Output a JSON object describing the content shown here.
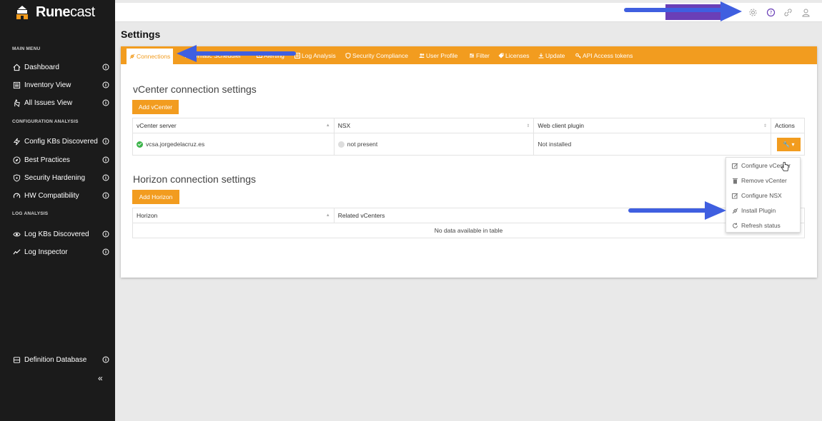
{
  "brand": {
    "name_a": "Rune",
    "name_b": "cast"
  },
  "sidebar": {
    "sections": [
      {
        "title": "MAIN MENU"
      },
      {
        "title": "CONFIGURATION ANALYSIS"
      },
      {
        "title": "LOG ANALYSIS"
      }
    ],
    "items": [
      {
        "label": "Dashboard",
        "icon": "home-icon"
      },
      {
        "label": "Inventory View",
        "icon": "inventory-icon"
      },
      {
        "label": "All Issues View",
        "icon": "hand-icon"
      },
      {
        "label": "Config KBs Discovered",
        "icon": "bolt-icon"
      },
      {
        "label": "Best Practices",
        "icon": "compass-icon"
      },
      {
        "label": "Security Hardening",
        "icon": "shield-icon"
      },
      {
        "label": "HW Compatibility",
        "icon": "gauge-icon"
      },
      {
        "label": "Log KBs Discovered",
        "icon": "eye-icon"
      },
      {
        "label": "Log Inspector",
        "icon": "pulse-icon"
      },
      {
        "label": "Definition Database",
        "icon": "database-icon"
      }
    ],
    "collapse_glyph": "«"
  },
  "page": {
    "title": "Settings"
  },
  "tabs": [
    {
      "label": "Connections",
      "active": true
    },
    {
      "label": "Automatic Scheduler"
    },
    {
      "label": "Alerting"
    },
    {
      "label": "Log Analysis"
    },
    {
      "label": "Security Compliance"
    },
    {
      "label": "User Profile"
    },
    {
      "label": "Filter"
    },
    {
      "label": "Licenses"
    },
    {
      "label": "Update"
    },
    {
      "label": "API Access tokens"
    }
  ],
  "vcenter": {
    "title": "vCenter connection settings",
    "add_button": "Add vCenter",
    "columns": [
      "vCenter server",
      "NSX",
      "Web client plugin",
      "Actions"
    ],
    "rows": [
      {
        "server": "vcsa.jorgedelacruz.es",
        "nsx": "not present",
        "plugin": "Not installed",
        "action_glyph": "🔧 ▾"
      }
    ]
  },
  "horizon": {
    "title": "Horizon connection settings",
    "add_button": "Add Horizon",
    "columns": [
      "Horizon",
      "Related vCenters"
    ],
    "empty": "No data available in table"
  },
  "dropdown": {
    "items": [
      {
        "label": "Configure vCenter",
        "icon": "edit-icon"
      },
      {
        "label": "Remove vCenter",
        "icon": "trash-icon"
      },
      {
        "label": "Configure NSX",
        "icon": "edit-icon"
      },
      {
        "label": "Install Plugin",
        "icon": "plug-icon"
      },
      {
        "label": "Refresh status",
        "icon": "refresh-icon"
      }
    ]
  },
  "colors": {
    "accent": "#f29c1f",
    "sidebar": "#1b1b1b",
    "annotation_arrow": "#3f5fe0"
  }
}
